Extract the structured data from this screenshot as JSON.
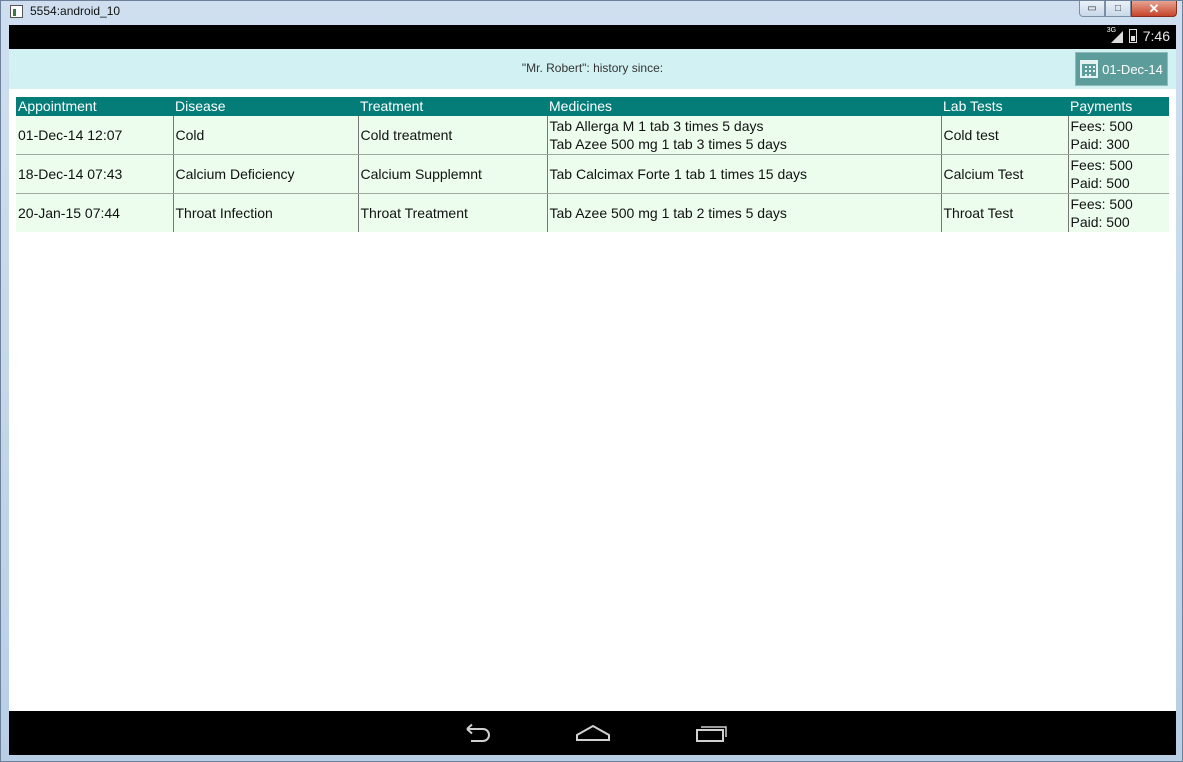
{
  "window": {
    "title": "5554:android_10",
    "minimize_glyph": "▭",
    "maximize_glyph": "□",
    "close_glyph": "✕"
  },
  "status_bar": {
    "network": "3G",
    "time": "7:46"
  },
  "header": {
    "history_label": "\"Mr. Robert\": history since:",
    "date_button": "01-Dec-14",
    "date_icon": "calendar-icon"
  },
  "table": {
    "columns": [
      "Appointment",
      "Disease",
      "Treatment",
      "Medicines",
      "Lab Tests",
      "Payments"
    ],
    "rows": [
      {
        "appointment": "01-Dec-14 12:07",
        "disease": "Cold",
        "treatment": "Cold treatment",
        "medicines": [
          "Tab Allerga M 1 tab 3 times 5 days",
          "Tab Azee 500 mg 1 tab 3 times 5 days"
        ],
        "lab_tests": "Cold test",
        "payments": [
          "Fees: 500",
          "Paid: 300"
        ]
      },
      {
        "appointment": "18-Dec-14 07:43",
        "disease": "Calcium Deficiency",
        "treatment": "Calcium Supplemnt",
        "medicines": [
          "Tab Calcimax Forte 1 tab 1 times 15 days"
        ],
        "lab_tests": "Calcium Test",
        "payments": [
          "Fees: 500",
          "Paid: 500"
        ]
      },
      {
        "appointment": "20-Jan-15 07:44",
        "disease": "Throat Infection",
        "treatment": "Throat Treatment",
        "medicines": [
          "Tab Azee 500 mg 1 tab 2 times 5 days"
        ],
        "lab_tests": "Throat Test",
        "payments": [
          "Fees: 500",
          "Paid: 500"
        ]
      }
    ]
  },
  "nav_bar": {
    "buttons": [
      "back-icon",
      "home-icon",
      "recents-icon"
    ]
  },
  "colors": {
    "header_bar": "#d2f1f3",
    "table_header": "#047d79",
    "table_row": "#ecfdee",
    "date_button": "#5c9c9a"
  }
}
